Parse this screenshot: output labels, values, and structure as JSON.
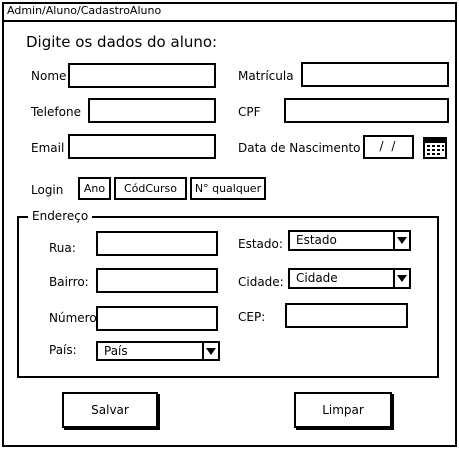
{
  "window": {
    "breadcrumb": "Admin/Aluno/CadastroAluno"
  },
  "form": {
    "heading": "Digite os dados do aluno:",
    "nome_label": "Nome",
    "matricula_label": "Matrícula",
    "telefone_label": "Telefone",
    "cpf_label": "CPF",
    "email_label": "Email",
    "data_nascimento_label": "Data de Nascimento",
    "data_nascimento_value": "/ /",
    "login_label": "Login",
    "login_parts": [
      "Ano",
      "CódCurso",
      "N° qualquer"
    ]
  },
  "endereco": {
    "legend": "Endereço",
    "rua_label": "Rua:",
    "bairro_label": "Bairro:",
    "numero_label": "Número",
    "pais_label": "País:",
    "pais_value": "País",
    "estado_label": "Estado:",
    "estado_value": "Estado",
    "cidade_label": "Cidade:",
    "cidade_value": "Cidade",
    "cep_label": "CEP:"
  },
  "actions": {
    "salvar": "Salvar",
    "limpar": "Limpar"
  },
  "icons": {
    "calendar": "calendar-icon",
    "dropdown": "chevron-down-icon"
  }
}
